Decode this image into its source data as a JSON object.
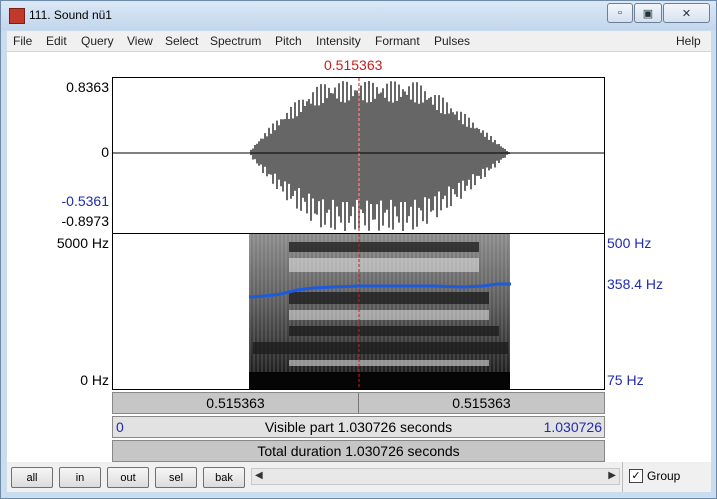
{
  "window": {
    "title": "111. Sound nü1"
  },
  "menu": [
    "File",
    "Edit",
    "Query",
    "View",
    "Select",
    "Spectrum",
    "Pitch",
    "Intensity",
    "Formant",
    "Pulses"
  ],
  "help_label": "Help",
  "cursor_time_label": "0.515363",
  "waveform": {
    "max": "0.8363",
    "zero": "0",
    "neg_cursor": "-0.5361",
    "min": "-0.8973"
  },
  "spectrogram": {
    "freq_top": "5000 Hz",
    "freq_bottom": "0 Hz",
    "pitch_top": "500 Hz",
    "pitch_value": "358.4 Hz",
    "pitch_bottom": "75 Hz"
  },
  "time_bars": {
    "left_segment": "0.515363",
    "right_segment": "0.515363",
    "visible_start": "0",
    "visible_label": "Visible part 1.030726 seconds",
    "visible_end": "1.030726",
    "total_label": "Total duration 1.030726 seconds"
  },
  "buttons": {
    "all": "all",
    "in": "in",
    "out": "out",
    "sel": "sel",
    "bak": "bak"
  },
  "group_label": "Group",
  "group_checked": true,
  "colors": {
    "cursor": "#c81e1e",
    "pitch": "#1e5adc",
    "axis_blue": "#1f2bb0"
  }
}
